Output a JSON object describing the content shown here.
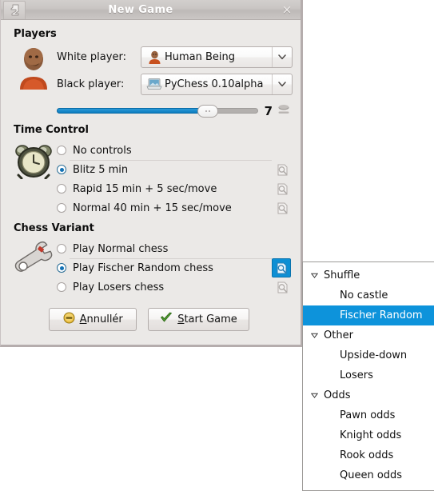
{
  "window": {
    "title": "New Game",
    "icon": "chess-piece-icon",
    "close_label": "×"
  },
  "players": {
    "section_title": "Players",
    "section_icon": "human-avatar-icon",
    "white": {
      "label": "White player:",
      "value": "Human Being",
      "icon": "human-avatar-icon",
      "arrow": "chevron-down-icon"
    },
    "black": {
      "label": "Black player:",
      "value": "PyChess 0.10alpha",
      "icon": "computer-laptop-icon",
      "arrow": "chevron-down-icon"
    },
    "strength": {
      "value": "7",
      "fill_percent": 78,
      "icon": "engine-strength-icon"
    }
  },
  "time_control": {
    "section_title": "Time Control",
    "section_icon": "alarm-clock-icon",
    "options": [
      {
        "label": "No controls",
        "selected": false,
        "has_inspect": false
      },
      {
        "label": "Blitz 5 min",
        "selected": true,
        "has_inspect": true
      },
      {
        "label": "Rapid 15 min + 5 sec/move",
        "selected": false,
        "has_inspect": true
      },
      {
        "label": "Normal 40 min + 15 sec/move",
        "selected": false,
        "has_inspect": true
      }
    ]
  },
  "chess_variant": {
    "section_title": "Chess Variant",
    "section_icon": "wrench-icon",
    "options": [
      {
        "label": "Play Normal chess",
        "selected": false,
        "has_inspect": false,
        "inspect_active": false
      },
      {
        "label": "Play Fischer Random chess",
        "selected": true,
        "has_inspect": true,
        "inspect_active": true
      },
      {
        "label": "Play Losers chess",
        "selected": false,
        "has_inspect": true,
        "inspect_active": false
      }
    ]
  },
  "buttons": {
    "cancel": {
      "label": "Annullér",
      "mnemonic": "A",
      "rest": "nnullér",
      "icon": "cancel-icon"
    },
    "start": {
      "label": "Start Game",
      "mnemonic": "S",
      "rest": "tart Game",
      "icon": "check-icon"
    }
  },
  "variant_menu": {
    "groups": [
      {
        "label": "Shuffle",
        "expander": "triangle-down-icon",
        "items": [
          {
            "label": "No castle",
            "selected": false
          },
          {
            "label": "Fischer Random",
            "selected": true
          }
        ]
      },
      {
        "label": "Other",
        "expander": "triangle-down-icon",
        "items": [
          {
            "label": "Upside-down",
            "selected": false
          },
          {
            "label": "Losers",
            "selected": false
          }
        ]
      },
      {
        "label": "Odds",
        "expander": "triangle-down-icon",
        "items": [
          {
            "label": "Pawn odds",
            "selected": false
          },
          {
            "label": "Knight odds",
            "selected": false
          },
          {
            "label": "Rook odds",
            "selected": false
          },
          {
            "label": "Queen odds",
            "selected": false
          }
        ]
      }
    ]
  },
  "colors": {
    "accent": "#0d93db",
    "dialog_bg": "#ebe9e7",
    "slider_fill": "#1a8ad0"
  }
}
